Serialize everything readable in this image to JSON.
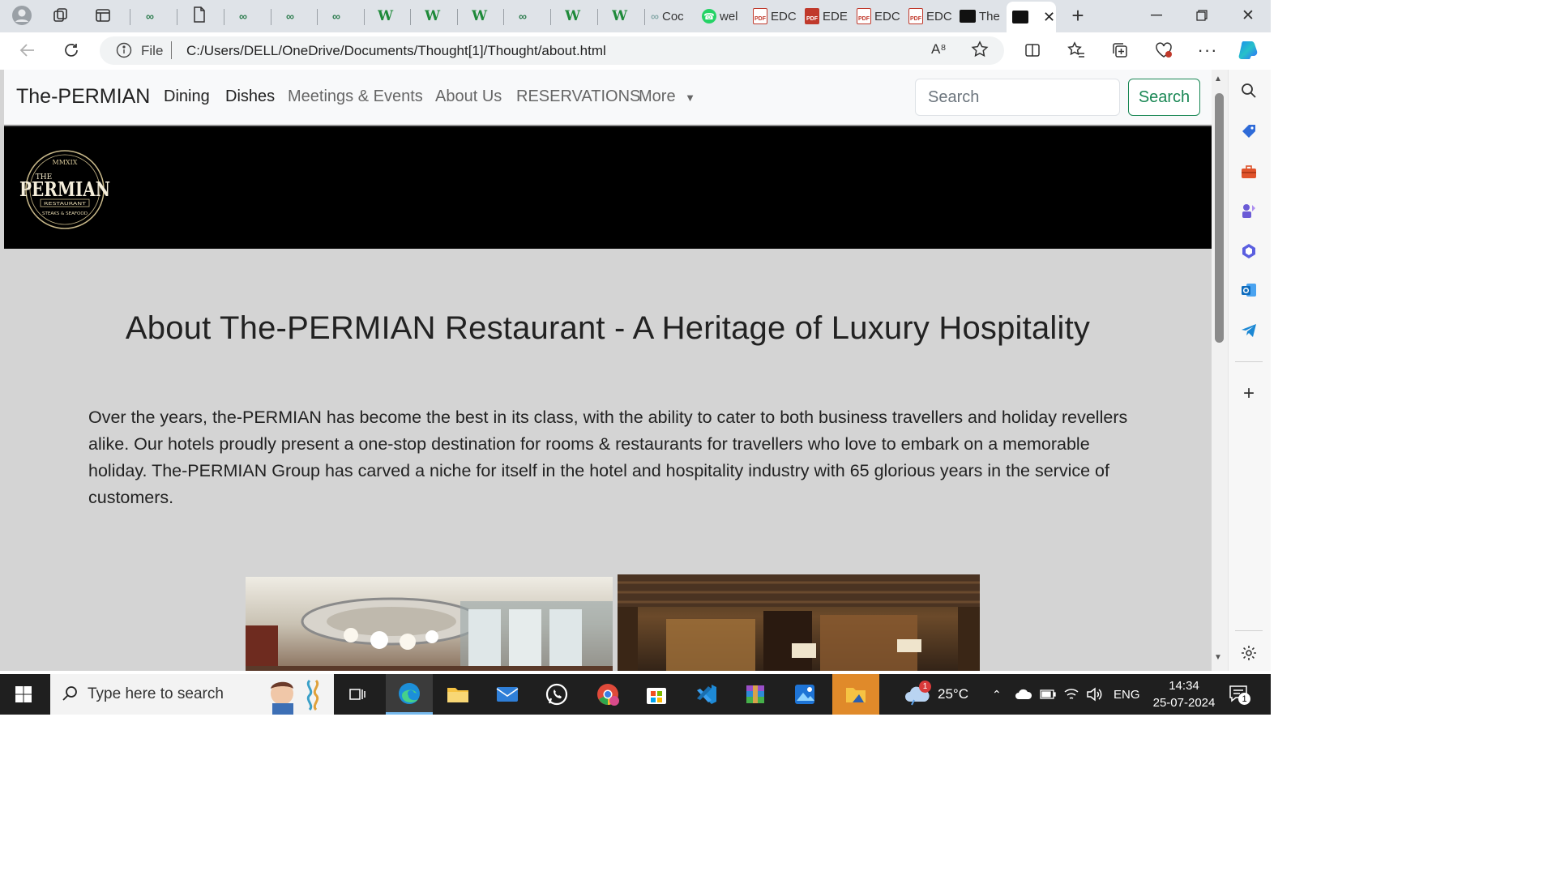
{
  "browser": {
    "tabs": [
      {
        "kind": "green",
        "label": ""
      },
      {
        "kind": "doc",
        "label": ""
      },
      {
        "kind": "green",
        "label": ""
      },
      {
        "kind": "green",
        "label": ""
      },
      {
        "kind": "green",
        "label": ""
      },
      {
        "kind": "w",
        "label": ""
      },
      {
        "kind": "w",
        "label": ""
      },
      {
        "kind": "w",
        "label": ""
      },
      {
        "kind": "green",
        "label": ""
      },
      {
        "kind": "w",
        "label": ""
      },
      {
        "kind": "w",
        "label": ""
      },
      {
        "kind": "green",
        "label": "Coc"
      },
      {
        "kind": "whatsapp",
        "label": "wel"
      },
      {
        "kind": "pdf",
        "label": "EDC"
      },
      {
        "kind": "pdf-solid",
        "label": "EDE"
      },
      {
        "kind": "pdf",
        "label": "EDC"
      },
      {
        "kind": "pdf",
        "label": "EDC"
      },
      {
        "kind": "dark",
        "label": "The"
      },
      {
        "kind": "dark",
        "label": ""
      }
    ],
    "url_scheme_label": "File",
    "url": "C:/Users/DELL/OneDrive/Documents/Thought[1]/Thought/about.html"
  },
  "page": {
    "brand": "The-PERMIAN",
    "nav": [
      "Dining",
      "Dishes",
      "Meetings & Events",
      "About Us",
      "RESERVATIONS",
      "More"
    ],
    "search_placeholder": "Search",
    "search_button": "Search",
    "logo": {
      "top": "MMXIX",
      "main": "PERMIAN",
      "the": "THE",
      "sub1": "RESTAURANT",
      "sub2": "STEAKS & SEAFOOD"
    },
    "headline": "About The-PERMIAN Restaurant - A Heritage of Luxury Hospitality",
    "paragraph": "Over the years, the-PERMIAN has become the best in its class, with the ability to cater to both business travellers and holiday revellers alike. Our hotels proudly present a one-stop destination for rooms & restaurants for travellers who love to embark on a memorable holiday. The-PERMIAN Group has carved a niche for itself in the hotel and hospitality industry with 65 glorious years in the service of customers."
  },
  "taskbar": {
    "search_placeholder": "Type here to search",
    "weather_temp": "25°C",
    "weather_badge": "1",
    "language": "ENG",
    "time": "14:34",
    "date": "25-07-2024",
    "notification_count": "1"
  }
}
